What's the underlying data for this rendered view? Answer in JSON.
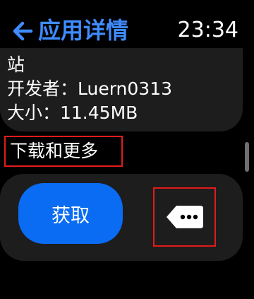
{
  "header": {
    "back_icon": "back-arrow-icon",
    "title": "应用详情",
    "time": "23:34",
    "accent_color": "#3f8cff"
  },
  "info": {
    "continued_text": "站",
    "developer_line": "开发者：Luern0313",
    "size_line": "大小：11.45MB"
  },
  "section": {
    "heading": "下载和更多",
    "highlight_color": "#e21b1b"
  },
  "actions": {
    "get_label": "获取",
    "get_color": "#0a6cf2",
    "more_icon": "more-options-tag-icon"
  }
}
